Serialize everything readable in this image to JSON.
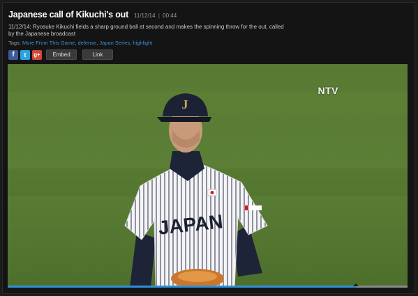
{
  "video": {
    "title": "Japanese call of Kikuchi's out",
    "date": "11/12/14",
    "separator": "|",
    "duration": "00:44",
    "description": "11/12/14: Ryosuke Kikuchi fields a sharp ground ball at second and makes the spinning throw for the out, called by the Japanese broadcast",
    "tags_label": "Tags:",
    "tags": [
      "More From This Game",
      "defense",
      "Japan Series",
      "highlight"
    ]
  },
  "share": {
    "facebook_icon": "f",
    "twitter_icon": "t",
    "googleplus_icon": "g+",
    "embed_label": "Embed",
    "link_label": "Link"
  },
  "player": {
    "channel_watermark": "NTV",
    "jersey_text": "JAPAN",
    "cap_logo": "J",
    "progress": 0.87,
    "colors": {
      "progress_fill": "#2f8fd8",
      "field_green": "#4f6f2f",
      "cap_navy": "#1c2233"
    }
  }
}
